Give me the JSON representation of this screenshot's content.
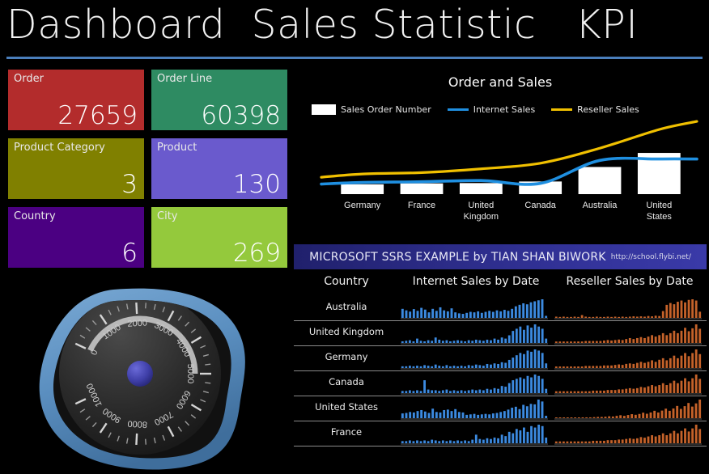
{
  "header": {
    "title": "Dashboard  Sales Statistic   KPI",
    "rule_color": "#4a7ebb"
  },
  "kpi_tiles": [
    {
      "label": "Order",
      "value": "27659",
      "color": "#b32c2c"
    },
    {
      "label": "Order Line",
      "value": "60398",
      "color": "#2e8b62"
    },
    {
      "label": "Product Category",
      "value": "3",
      "color": "#808000"
    },
    {
      "label": "Product",
      "value": "130",
      "color": "#6a5acd"
    },
    {
      "label": "Country",
      "value": "6",
      "color": "#4b0082"
    },
    {
      "label": "City",
      "value": "269",
      "color": "#94c93c"
    }
  ],
  "gauge": {
    "min": 0,
    "max": 10000,
    "value": 5000,
    "tick_labels": [
      "0",
      "1000",
      "2000",
      "3000",
      "4000",
      "5000",
      "6000",
      "7000",
      "8000",
      "9000",
      "10000"
    ],
    "frame_color": "#5b8fc0",
    "face_color": "#2b2b2b",
    "needle_color": "#c8c8c8",
    "pivot_color": "#3f3fa8"
  },
  "chart_data": {
    "type": "bar",
    "title": "Order and Sales",
    "xlabel": "",
    "ylabel": "",
    "grid": false,
    "legend_position": "top",
    "categories": [
      "Germany",
      "France",
      "United Kingdom",
      "Canada",
      "Australia",
      "United States"
    ],
    "series": [
      {
        "name": "Sales Order Number",
        "type": "bar",
        "color": "#ffffff",
        "values": [
          1050,
          1150,
          1180,
          1350,
          2900,
          4400
        ]
      },
      {
        "name": "Internet Sales",
        "type": "line",
        "color": "#1f8fe0",
        "values": [
          1250,
          1320,
          1450,
          1150,
          3600,
          3750
        ]
      },
      {
        "name": "Reseller Sales",
        "type": "line",
        "color": "#f0c000",
        "values": [
          2150,
          2300,
          2700,
          3300,
          4900,
          6900
        ]
      }
    ],
    "ylim": [
      0,
      7600
    ]
  },
  "banner": {
    "text": "MICROSOFT SSRS EXAMPLE by TIAN SHAN BIWORK",
    "url": "http://school.flybi.net/"
  },
  "spark_table": {
    "columns": [
      "Country",
      "Internet Sales by Date",
      "Reseller Sales by Date"
    ],
    "internet_color": "#3c8ae0",
    "reseller_color": "#c4622a",
    "rows": [
      {
        "country": "Australia",
        "internet": [
          36,
          30,
          25,
          35,
          28,
          40,
          33,
          22,
          36,
          28,
          42,
          30,
          26,
          38,
          22,
          18,
          16,
          20,
          24,
          22,
          26,
          20,
          24,
          28,
          24,
          30,
          26,
          32,
          28,
          36,
          46,
          52,
          58,
          54,
          62,
          66,
          70,
          74,
          8
        ],
        "reseller": [
          4,
          3,
          4,
          3,
          3,
          4,
          3,
          9,
          4,
          3,
          3,
          4,
          3,
          3,
          4,
          3,
          4,
          3,
          4,
          3,
          4,
          5,
          4,
          5,
          4,
          6,
          5,
          7,
          6,
          22,
          42,
          48,
          44,
          52,
          56,
          50,
          58,
          60,
          56,
          20
        ]
      },
      {
        "country": "United Kingdom",
        "internet": [
          3,
          4,
          5,
          3,
          8,
          4,
          3,
          5,
          4,
          10,
          6,
          4,
          5,
          3,
          4,
          5,
          4,
          3,
          5,
          4,
          6,
          5,
          4,
          6,
          5,
          8,
          6,
          10,
          8,
          14,
          22,
          26,
          30,
          24,
          32,
          28,
          34,
          30,
          26,
          8
        ]
      },
      {
        "country": "Germany",
        "internet": [
          3,
          3,
          4,
          3,
          4,
          3,
          5,
          4,
          3,
          6,
          4,
          3,
          5,
          3,
          4,
          3,
          4,
          3,
          5,
          4,
          6,
          5,
          4,
          7,
          6,
          8,
          7,
          10,
          9,
          14,
          18,
          22,
          26,
          24,
          30,
          28,
          32,
          30,
          26,
          8
        ]
      },
      {
        "country": "Canada",
        "internet": [
          3,
          3,
          4,
          3,
          4,
          3,
          18,
          5,
          4,
          4,
          3,
          4,
          5,
          3,
          4,
          3,
          4,
          3,
          4,
          5,
          4,
          5,
          4,
          6,
          5,
          7,
          6,
          10,
          9,
          14,
          18,
          20,
          22,
          20,
          24,
          22,
          26,
          24,
          20,
          6
        ]
      },
      {
        "country": "United States",
        "internet": [
          20,
          22,
          26,
          24,
          30,
          34,
          28,
          22,
          40,
          26,
          24,
          34,
          36,
          30,
          38,
          26,
          24,
          14,
          16,
          18,
          14,
          16,
          18,
          16,
          20,
          22,
          26,
          30,
          36,
          44,
          48,
          38,
          56,
          50,
          60,
          58,
          78,
          70,
          10
        ]
      },
      {
        "country": "France",
        "internet": [
          3,
          3,
          4,
          3,
          4,
          3,
          4,
          3,
          5,
          4,
          3,
          4,
          3,
          4,
          3,
          4,
          3,
          4,
          3,
          5,
          12,
          6,
          5,
          7,
          6,
          8,
          7,
          12,
          10,
          16,
          14,
          20,
          18,
          22,
          16,
          24,
          22,
          26,
          24,
          8
        ]
      }
    ]
  }
}
